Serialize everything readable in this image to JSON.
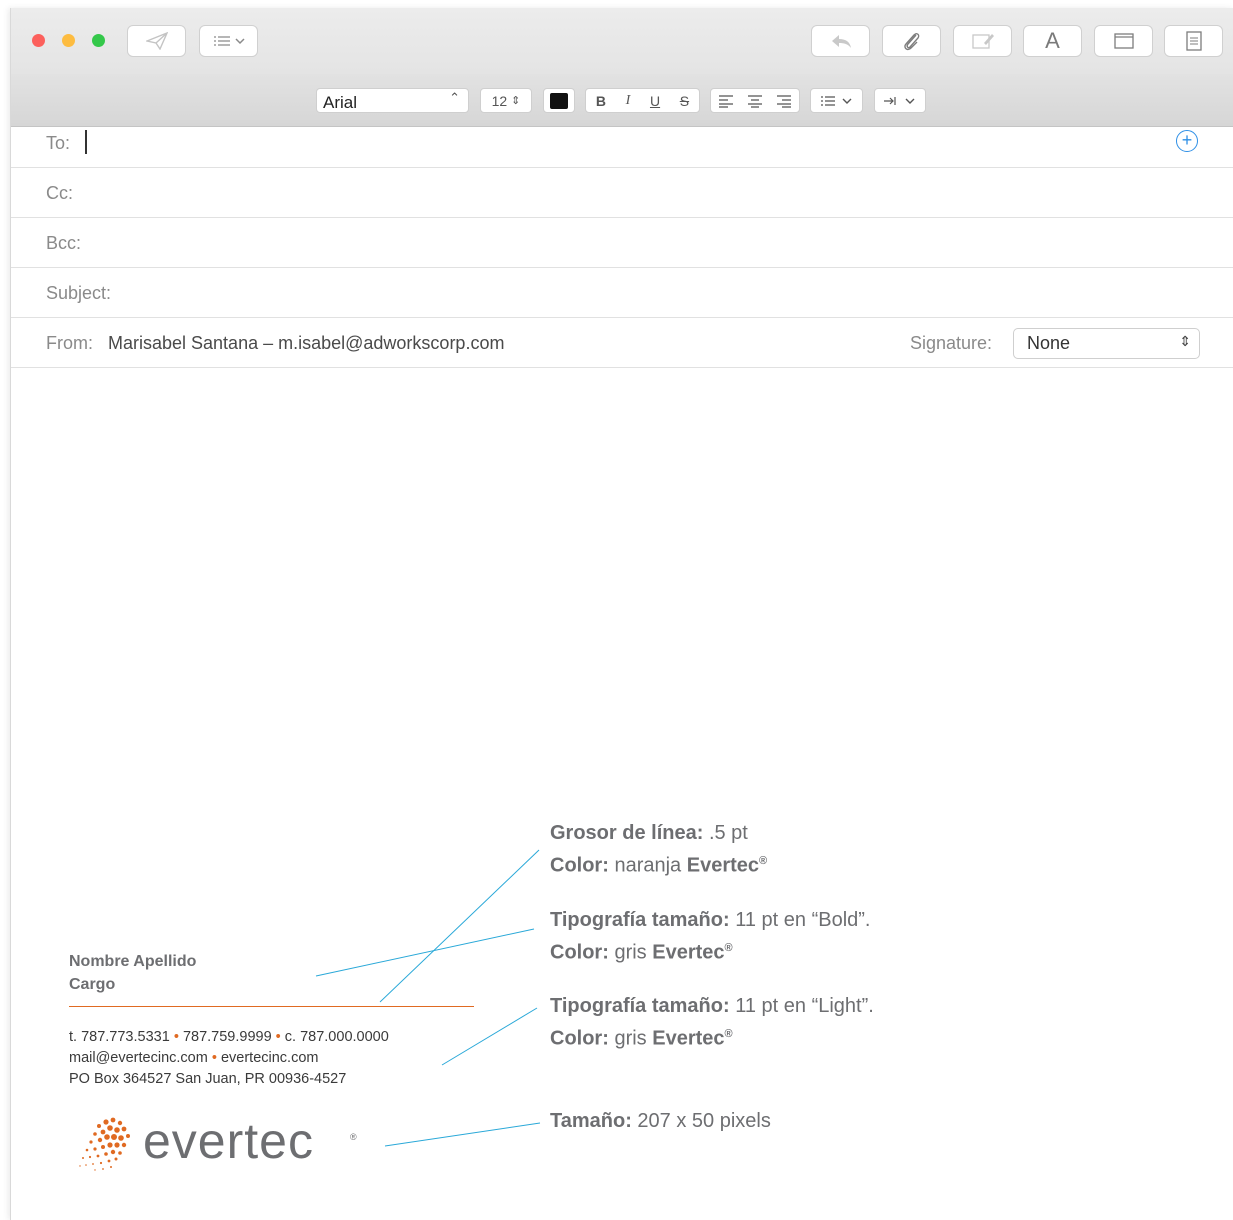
{
  "toolbar": {
    "font_name": "Arial",
    "font_size": "12",
    "bold": "B",
    "italic": "I",
    "underline": "U",
    "strike": "S",
    "text_tool": "A"
  },
  "header": {
    "to_label": "To:",
    "cc_label": "Cc:",
    "bcc_label": "Bcc:",
    "subject_label": "Subject:",
    "from_label": "From:",
    "from_value": "Marisabel Santana – m.isabel@adworkscorp.com",
    "signature_label": "Signature:",
    "signature_value": "None"
  },
  "signature": {
    "name": "Nombre Apellido",
    "title": "Cargo",
    "phone_t": "t. 787.773.5331",
    "phone_2": "787.759.9999",
    "phone_c": "c. 787.000.0000",
    "email": "mail@evertecinc.com",
    "website": "evertecinc.com",
    "address": "PO Box 364527 San Juan, PR 00936-4527",
    "logo_text": "evertec",
    "bullet": "•"
  },
  "annotations": {
    "a1_l1_bold": "Grosor de línea:",
    "a1_l1_rest": ".5 pt",
    "a1_l2_bold": "Color:",
    "a1_l2_rest": "naranja",
    "a2_l1_bold": "Tipografía tamaño:",
    "a2_l1_rest": "11 pt en “Bold”.",
    "a2_l2_bold": "Color:",
    "a2_l2_rest": "gris",
    "a3_l1_bold": "Tipografía tamaño:",
    "a3_l1_rest": "11 pt en “Light”.",
    "a3_l2_bold": "Color:",
    "a3_l2_rest": "gris",
    "a4_bold": "Tamaño:",
    "a4_rest": "207 x 50 pixels",
    "brand": "Evertec",
    "reg": "®"
  },
  "colors": {
    "evertec_orange": "#e06a22",
    "evertec_gray": "#6d6e71",
    "callout_line": "#29a8d8",
    "add_button": "#2e8fe6"
  }
}
